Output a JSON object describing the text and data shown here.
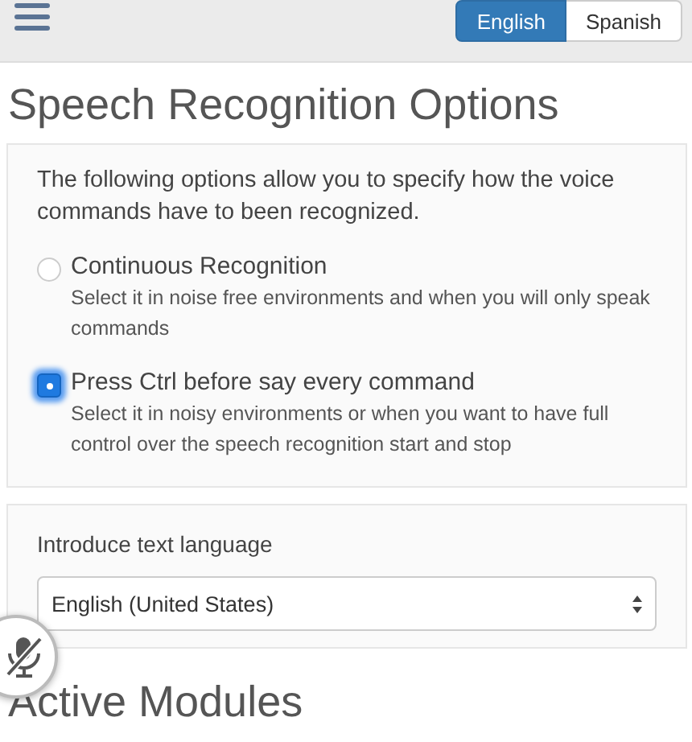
{
  "language_buttons": [
    {
      "label": "English",
      "selected": true
    },
    {
      "label": "Spanish",
      "selected": false
    }
  ],
  "title": "Speech Recognition Options",
  "recognition_panel": {
    "intro": "The following options allow you to specify how the voice commands have to been recognized.",
    "options": [
      {
        "label": "Continuous Recognition",
        "description": "Select it in noise free environments and when you will only speak commands",
        "selected": false
      },
      {
        "label": "Press Ctrl before say every command",
        "description": "Select it in noisy environments or when you want to have full control over the speech recognition start and stop",
        "selected": true
      }
    ]
  },
  "language_panel": {
    "label": "Introduce text language",
    "value": "English (United States)"
  },
  "microphone": {
    "muted": true
  },
  "section_heading": "Active Modules"
}
